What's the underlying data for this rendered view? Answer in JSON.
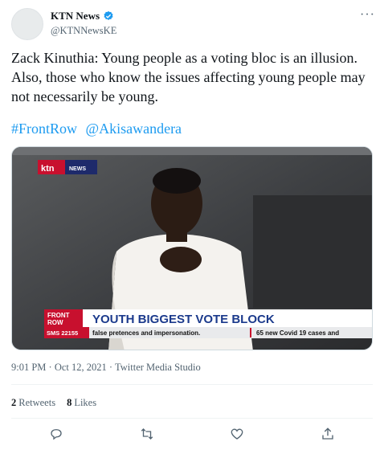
{
  "author": {
    "name": "KTN News",
    "handle": "@KTNNewsKE"
  },
  "tweet": {
    "text": "Zack Kinuthia: Young people as a voting bloc is an illusion. Also, those who know the issues affecting young people may not necessarily be young.",
    "hashtag": "#FrontRow",
    "mention": "@Akisawandera"
  },
  "media": {
    "channel_logo": "ktn",
    "channel_tag": "NEWS",
    "show_badge_line1": "FRONT",
    "show_badge_line2": "ROW",
    "headline": "YOUTH BIGGEST VOTE BLOCK",
    "ticker_sms": "SMS 22155",
    "ticker_text": "false pretences and impersonation.",
    "ticker_text_2": "65 new Covid 19 cases and"
  },
  "meta": {
    "time": "9:01 PM",
    "separator": "·",
    "date": "Oct 12, 2021",
    "source": "Twitter Media Studio"
  },
  "stats": {
    "retweets_count": "2",
    "retweets_label": "Retweets",
    "likes_count": "8",
    "likes_label": "Likes"
  },
  "colors": {
    "accent": "#1d9bf0",
    "headline_red": "#c8102e",
    "headline_blue": "#1b3a8c"
  },
  "icons": [
    "verified-badge-icon",
    "more-icon",
    "reply-icon",
    "retweet-icon",
    "like-icon",
    "share-icon"
  ]
}
